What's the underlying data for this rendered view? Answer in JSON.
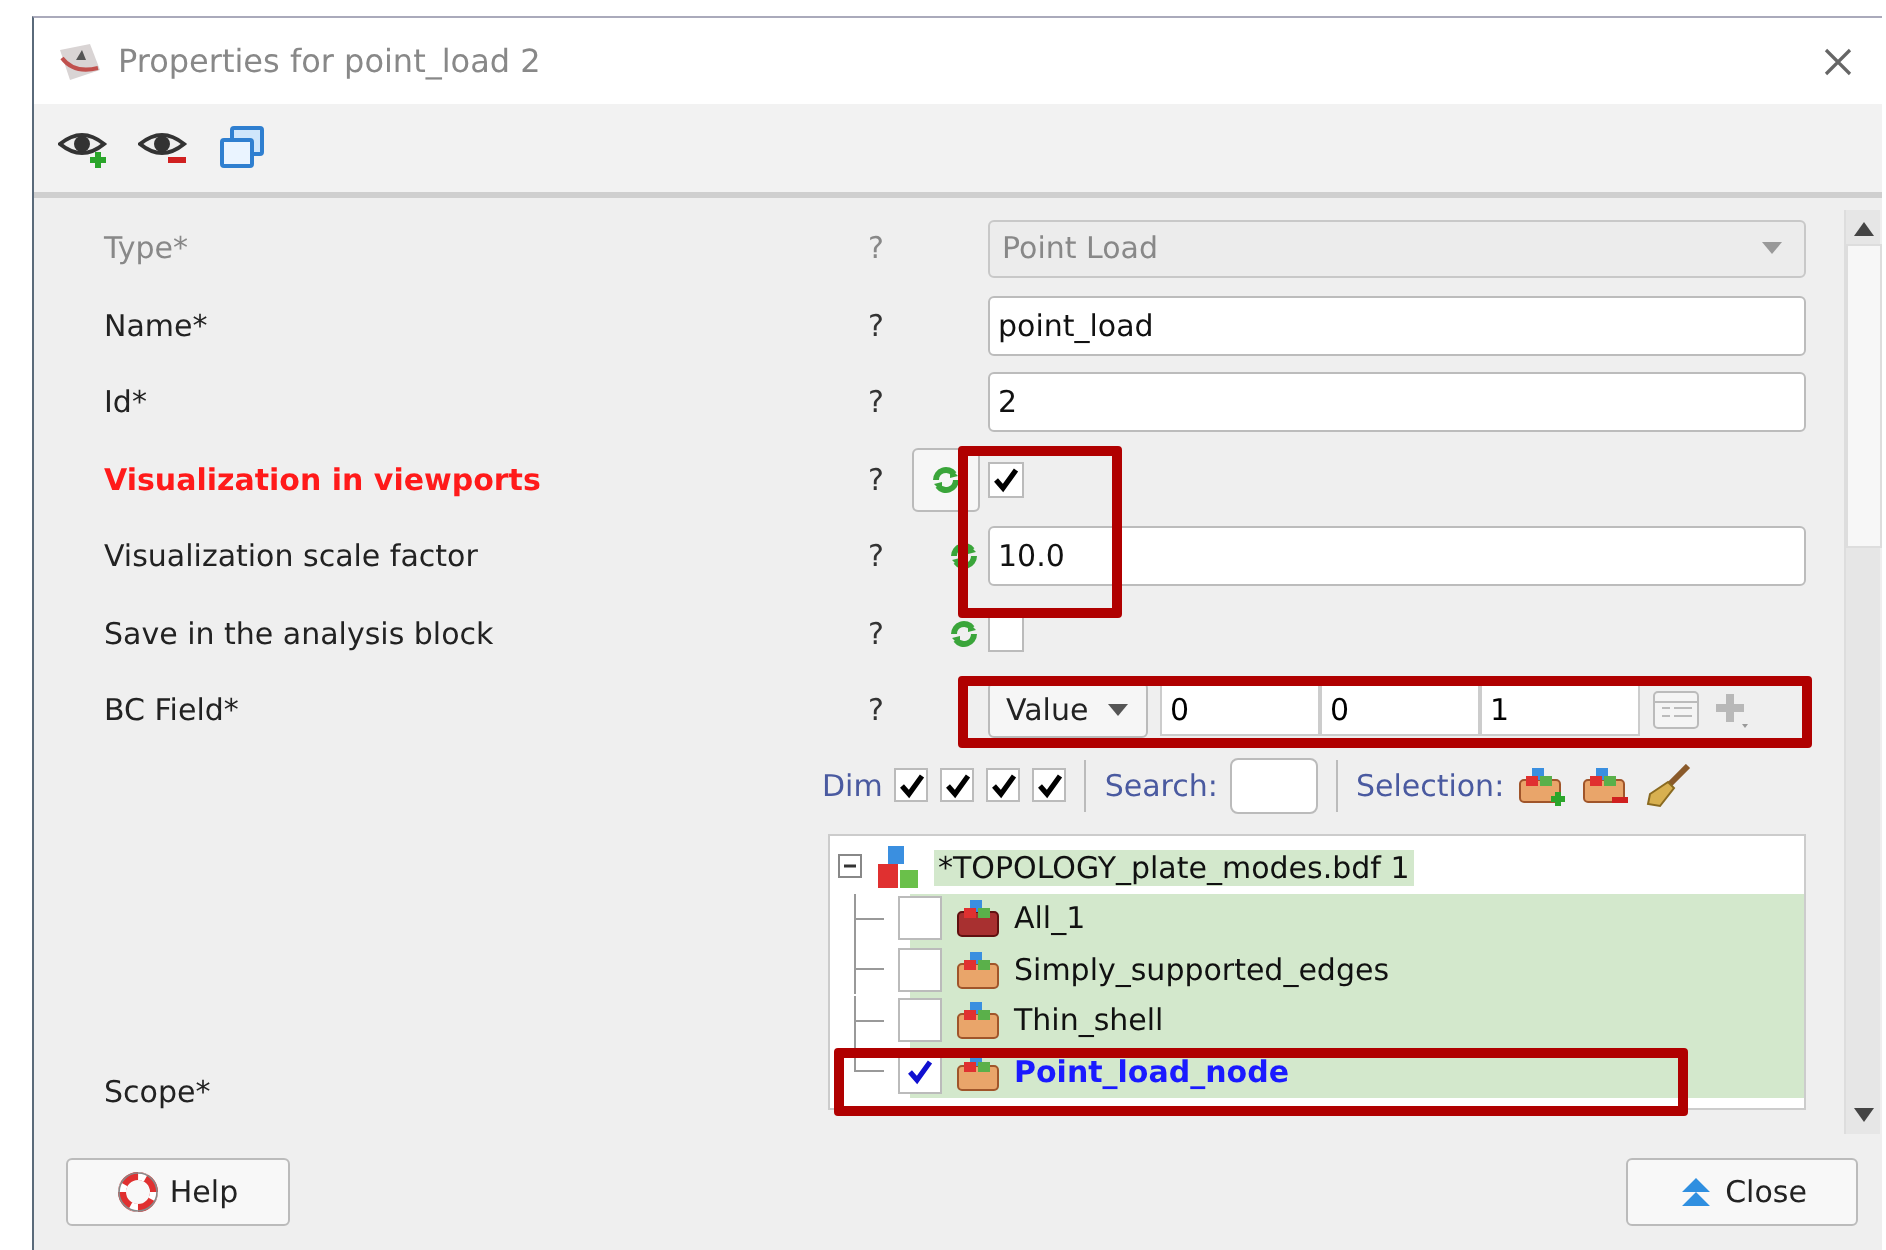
{
  "window": {
    "title": "Properties for point_load 2"
  },
  "fields": [
    {
      "label": "Type*",
      "help": "?",
      "kind": "combo",
      "value": "Point Load",
      "disabled": true,
      "invalid": false,
      "refresh": false
    },
    {
      "label": "Name*",
      "help": "?",
      "kind": "text",
      "value": "point_load",
      "disabled": false,
      "invalid": false,
      "refresh": false
    },
    {
      "label": "Id*",
      "help": "?",
      "kind": "text",
      "value": "2",
      "disabled": false,
      "invalid": false,
      "refresh": false
    },
    {
      "label": "Visualization in viewports",
      "help": "?",
      "kind": "checkbox",
      "checked": true,
      "disabled": false,
      "invalid": true,
      "refresh": true,
      "refresh_framed": true
    },
    {
      "label": "Visualization scale factor",
      "help": "?",
      "kind": "text",
      "value": "10.0",
      "disabled": false,
      "invalid": false,
      "refresh": true,
      "refresh_framed": false
    },
    {
      "label": "Save in the analysis block",
      "help": "?",
      "kind": "checkbox",
      "checked": false,
      "disabled": false,
      "invalid": false,
      "refresh": true,
      "refresh_framed": false
    },
    {
      "label": "BC Field*",
      "help": "?",
      "kind": "vector",
      "mode": "Value",
      "values": [
        "0",
        "0",
        "1"
      ],
      "disabled": false,
      "invalid": false,
      "refresh": false
    }
  ],
  "filter": {
    "label": "Dim",
    "dims": [
      {
        "checked": true
      },
      {
        "checked": true
      },
      {
        "checked": true
      },
      {
        "checked": true
      }
    ],
    "search_label": "Search:",
    "selection_label": "Selection:"
  },
  "tree": {
    "label": "*TOPOLOGY_plate_modes.bdf 1",
    "expanded": true,
    "children": [
      {
        "label": "All_1",
        "checked": false,
        "selected": false,
        "kind": "all"
      },
      {
        "label": "Simply_supported_edges",
        "checked": false,
        "selected": false,
        "kind": "group"
      },
      {
        "label": "Thin_shell",
        "checked": false,
        "selected": false,
        "kind": "group"
      },
      {
        "label": "Point_load_node",
        "checked": true,
        "selected": true,
        "kind": "group"
      }
    ]
  },
  "scope_label": "Scope*",
  "buttons": {
    "help": "Help",
    "close": "Close"
  }
}
